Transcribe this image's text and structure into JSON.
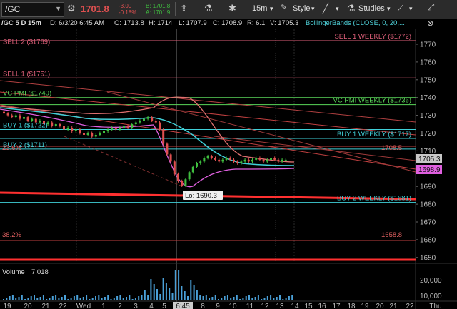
{
  "toolbar": {
    "symbol": "/GC",
    "last": "1701.8",
    "change": "-3.00",
    "change_pct": "-0.18%",
    "bid": "B: 1701.8",
    "ask": "A: 1701.9",
    "interval": "15m",
    "style_label": "Style",
    "studies_label": "Studies"
  },
  "infobar": {
    "title": "/GC 5 D 15m",
    "date": "D: 6/3/20 6:45 AM",
    "open": "O: 1713.8",
    "high": "H: 1714",
    "low": "L: 1707.9",
    "close": "C: 1708.9",
    "range": "R: 6.1",
    "value": "V: 1705.3",
    "study": "BollingerBands (CLOSE, 0, 20,..."
  },
  "levels": [
    {
      "label": "SELL 2 ($1769)",
      "price": 1769,
      "color": "#e0607a",
      "side": "left"
    },
    {
      "label": "SELL 1 ($1751)",
      "price": 1751,
      "color": "#e0607a",
      "side": "left"
    },
    {
      "label": "VC PMI ($1740)",
      "price": 1740,
      "color": "#5ad65a",
      "side": "left"
    },
    {
      "label": "BUY 1 ($1722)",
      "price": 1722,
      "color": "#40d0d8",
      "side": "left"
    },
    {
      "label": "BUY 2 ($1711)",
      "price": 1711,
      "color": "#40d0d8",
      "side": "left"
    },
    {
      "label": "SELL 1 WEEKLY ($1772)",
      "price": 1772,
      "color": "#e0607a",
      "side": "right"
    },
    {
      "label": "VC PMI WEEKLY ($1736)",
      "price": 1736,
      "color": "#5ad65a",
      "side": "right"
    },
    {
      "label": "BUY 1 WEEKLY ($1717)",
      "price": 1717,
      "color": "#40d0d8",
      "side": "right"
    },
    {
      "label": "BUY 2 WEEKLY ($1681)",
      "price": 1681,
      "color": "#40d0d8",
      "side": "right"
    }
  ],
  "annotations": {
    "fib1": "23.6%",
    "fib1_price": "1708.5",
    "fib2": "38.2%",
    "fib2_price": "1658.8",
    "low_label": "Lo: 1690.3",
    "price_tag_1": "1705.3",
    "price_tag_2": "1698.9"
  },
  "price_axis": [
    "1770",
    "1760",
    "1750",
    "1740",
    "1730",
    "1720",
    "1710",
    "1700",
    "1690",
    "1680",
    "1670",
    "1660",
    "1650"
  ],
  "volume": {
    "label": "Volume",
    "value": "7,018",
    "axis_top": "20,000",
    "axis_mid": "10,000"
  },
  "time_axis": [
    "19",
    "20",
    "21",
    "22",
    "Wed",
    "1",
    "2",
    "3",
    "4",
    "5",
    "6:45",
    "8",
    "9",
    "10",
    "11",
    "12",
    "13",
    "14",
    "15",
    "16",
    "17",
    "18",
    "19",
    "20",
    "21",
    "22",
    "Thu"
  ],
  "colors": {
    "red": "#e05050",
    "green": "#3fbf3f",
    "cyan": "#40d0d8",
    "pink": "#e0607a",
    "magenta": "#e060e0"
  }
}
